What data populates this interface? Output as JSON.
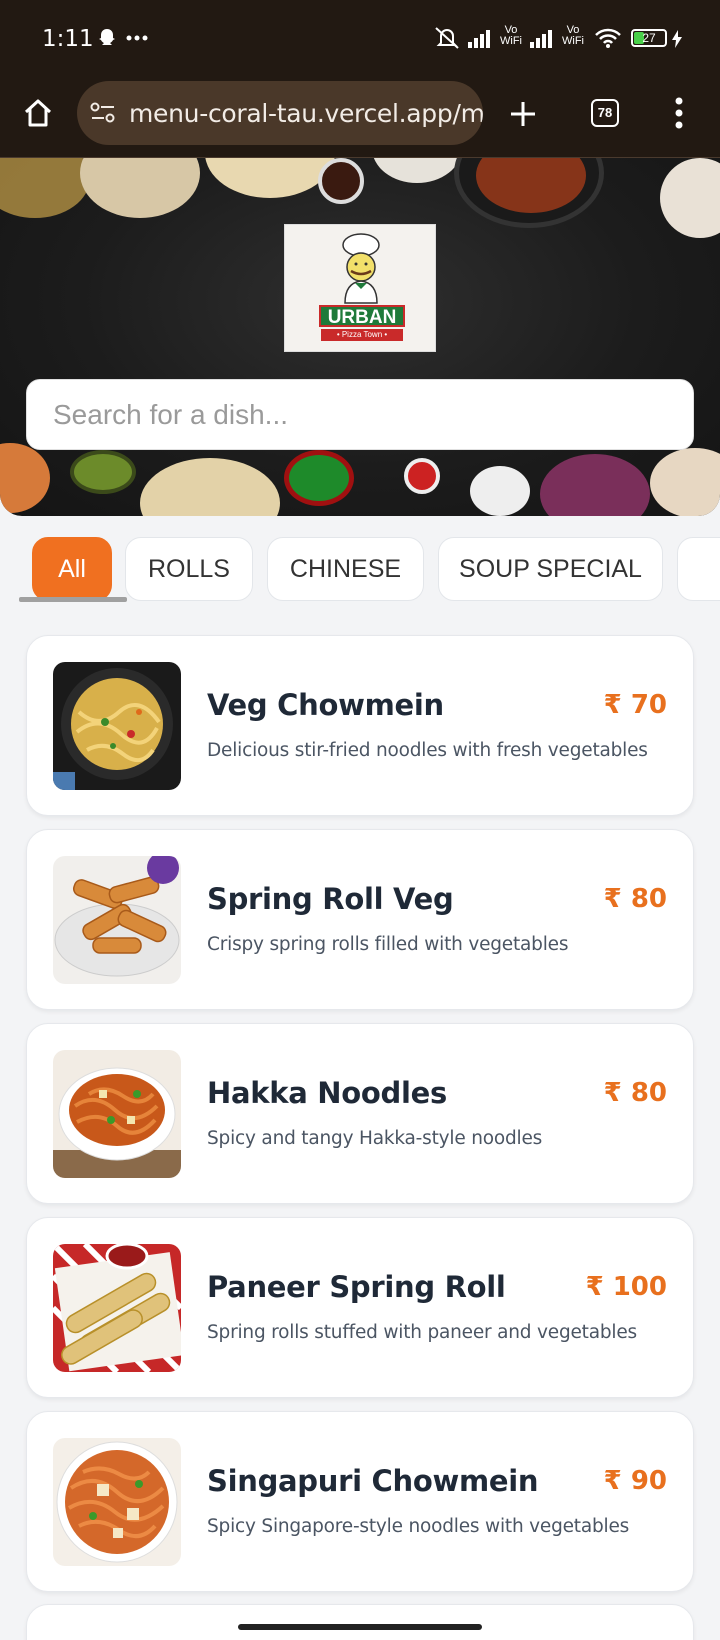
{
  "status_bar": {
    "time": "1:11",
    "icons": [
      "snapchat-icon",
      "more-dots-icon",
      "mute-icon",
      "signal-icon",
      "vowifi-icon",
      "signal-icon",
      "vowifi-icon",
      "wifi-icon",
      "battery-icon",
      "charging-icon"
    ],
    "battery_level": "27",
    "vowifi_top": "Vo",
    "vowifi_bottom": "WiFi"
  },
  "browser": {
    "url": "menu-coral-tau.vercel.app/m",
    "tab_count": "78"
  },
  "hero": {
    "logo_text": "URBAN",
    "logo_subtext": "• Pizza Town •"
  },
  "search": {
    "placeholder": "Search for a dish...",
    "value": ""
  },
  "categories": [
    {
      "label": "All",
      "active": true
    },
    {
      "label": "ROLLS",
      "active": false
    },
    {
      "label": "CHINESE",
      "active": false
    },
    {
      "label": "SOUP SPECIAL",
      "active": false
    }
  ],
  "menu_items": [
    {
      "name": "Veg Chowmein",
      "price": "₹ 70",
      "description": "Delicious stir-fried noodles with fresh vegetables"
    },
    {
      "name": "Spring Roll Veg",
      "price": "₹ 80",
      "description": "Crispy spring rolls filled with vegetables"
    },
    {
      "name": "Hakka Noodles",
      "price": "₹ 80",
      "description": "Spicy and tangy Hakka-style noodles"
    },
    {
      "name": "Paneer Spring Roll",
      "price": "₹ 100",
      "description": "Spring rolls stuffed with paneer and vegetables"
    },
    {
      "name": "Singapuri Chowmein",
      "price": "₹ 90",
      "description": "Spicy Singapore-style noodles with vegetables"
    }
  ],
  "colors": {
    "accent": "#f07020",
    "price": "#e8701e",
    "browser_bg": "#221912"
  }
}
